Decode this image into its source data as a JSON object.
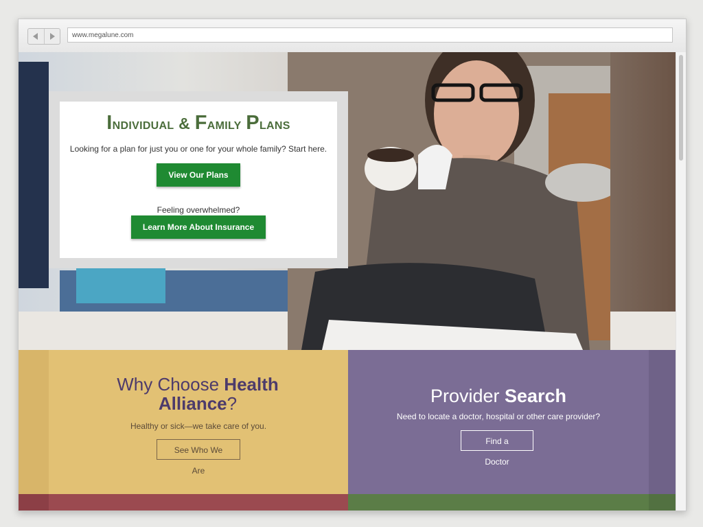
{
  "browser": {
    "url": "www.megalune.com"
  },
  "hero": {
    "title_first": "I",
    "title_rest": "ndividual & ",
    "title_second": "F",
    "title_rest2": "amily ",
    "title_third": "P",
    "title_rest3": "lans",
    "subtitle": "Looking for a plan for just you or one for your whole family? Start here.",
    "plans_button": "View Our Plans",
    "question": "Feeling overwhelmed?",
    "learn_button": "Learn More About Insurance"
  },
  "tiles": {
    "why": {
      "heading_normal": "Why Choose ",
      "heading_bold": "Health Alliance",
      "heading_end": "?",
      "text": "Healthy or sick—we take care of you.",
      "button": "See Who We Are"
    },
    "provider": {
      "heading_normal": "Provider ",
      "heading_bold": "Search",
      "text": "Need to locate a doctor, hospital or other care provider?",
      "button": "Find a Doctor"
    }
  },
  "colors": {
    "accent_green": "#1f8a32",
    "title_green": "#4b6d3b",
    "tile_yellow": "#e2c174",
    "tile_purple": "#7b6d95",
    "strip_red": "#9b4a50",
    "strip_green": "#5b7d47"
  },
  "icons": {
    "back": "back-arrow-icon",
    "forward": "forward-arrow-icon"
  }
}
